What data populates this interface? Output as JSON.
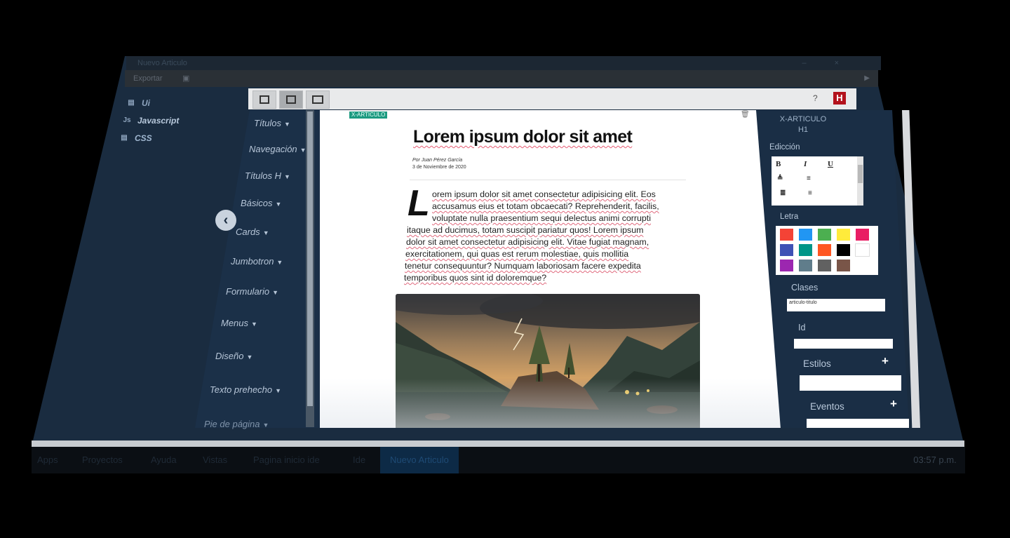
{
  "window": {
    "title": "Nuevo Articulo",
    "menu": {
      "export_label": "Exportar"
    }
  },
  "file_tree": [
    {
      "icon": "file-icon",
      "label": "Ui"
    },
    {
      "icon": "js-icon",
      "icon_text": "Js",
      "label": "Javascript"
    },
    {
      "icon": "css-icon",
      "label": "CSS"
    }
  ],
  "components": [
    "Títulos",
    "Navegación",
    "Títulos H",
    "Básicos",
    "Cards",
    "Jumbotron",
    "Formulario",
    "Menus",
    "Diseño",
    "Texto prehecho",
    "Pie de página"
  ],
  "toolbar": {
    "help_label": "?",
    "logo_text": "H"
  },
  "article": {
    "tag": "X-ARTICULO",
    "title": "Lorem ipsum dolor sit amet",
    "author": "Por Juan Pérez García",
    "date": "3 de Noviembre de 2020",
    "dropcap": "L",
    "lines": [
      "orem ipsum dolor sit amet consectetur adipisicing elit. Eos",
      "accusamus eius et totam obcaecati? Reprehenderit, facilis,",
      "voluptate nulla praesentium sequi delectus animi corrupti",
      "itaque ad ducimus, totam suscipit pariatur quos! Lorem ipsum",
      "dolor sit amet consectetur adipisicing elit. Vitae fugiat magnam,",
      "exercitationem, qui quas est rerum molestiae, quis mollitia",
      "tenetur consequuntur? Numquam laboriosam facere expedita",
      "temporibus quos sint id doloremque?"
    ]
  },
  "properties": {
    "element_name": "X-ARTICULO",
    "element_tag": "H1",
    "edicion_label": "Edicción",
    "format_buttons": [
      "B",
      "I",
      "U"
    ],
    "letra_label": "Letra",
    "colors": [
      "#f44336",
      "#2196f3",
      "#4caf50",
      "#ffeb3b",
      "#e91e63",
      "#3f51b5",
      "#009688",
      "#ff5722",
      "#000000",
      "#ffffff",
      "#9c27b0",
      "#607d8b",
      "#616161",
      "#795548"
    ],
    "clases_label": "Clases",
    "clases_value": "articulo-titulo",
    "id_label": "Id",
    "id_value": "",
    "estilos_label": "Estilos",
    "eventos_label": "Eventos"
  },
  "taskbar": {
    "items": [
      "Apps",
      "Proyectos",
      "Ayuda",
      "Vistas",
      "Pagina inicio ide",
      "Ide",
      "Nuevo Articulo"
    ],
    "active": "Nuevo Articulo",
    "clock": "03:57 p.m."
  }
}
